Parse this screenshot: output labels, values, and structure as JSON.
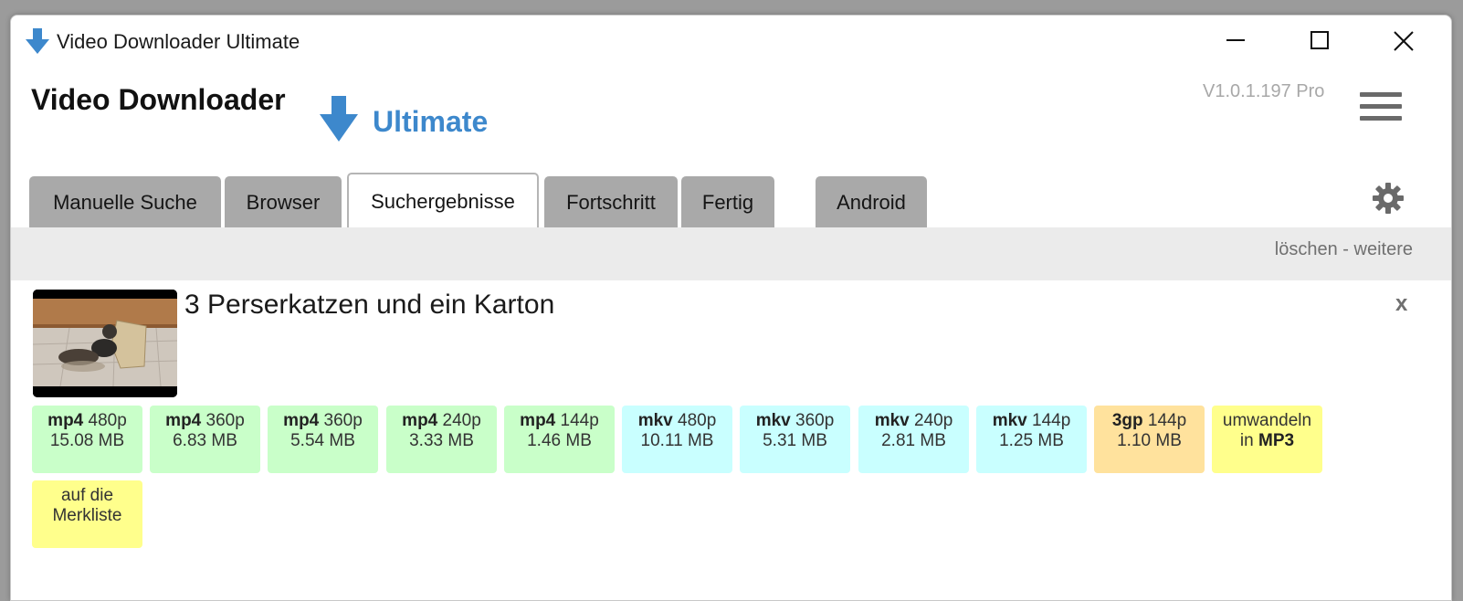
{
  "window": {
    "title": "Video Downloader Ultimate"
  },
  "header": {
    "app_name": "Video Downloader",
    "app_sub": "Ultimate",
    "version": "V1.0.1.197 Pro"
  },
  "tabs": [
    {
      "label": "Manuelle Suche",
      "active": false
    },
    {
      "label": "Browser",
      "active": false
    },
    {
      "label": "Suchergebnisse",
      "active": true
    },
    {
      "label": "Fortschritt",
      "active": false
    },
    {
      "label": "Fertig",
      "active": false
    },
    {
      "label": "Android",
      "active": false
    }
  ],
  "toolbar": {
    "clear": "löschen",
    "separator": " - ",
    "more": "weitere"
  },
  "result": {
    "title": "3 Perserkatzen und ein Karton",
    "close": "x",
    "downloads": [
      {
        "format": "mp4",
        "quality": "480p",
        "size": "15.08 MB",
        "color": "#c9ffc9"
      },
      {
        "format": "mp4",
        "quality": "360p",
        "size": "6.83 MB",
        "color": "#c9ffc9"
      },
      {
        "format": "mp4",
        "quality": "360p",
        "size": "5.54 MB",
        "color": "#c9ffc9"
      },
      {
        "format": "mp4",
        "quality": "240p",
        "size": "3.33 MB",
        "color": "#c9ffc9"
      },
      {
        "format": "mp4",
        "quality": "144p",
        "size": "1.46 MB",
        "color": "#c9ffc9"
      },
      {
        "format": "mkv",
        "quality": "480p",
        "size": "10.11 MB",
        "color": "#c9ffff"
      },
      {
        "format": "mkv",
        "quality": "360p",
        "size": "5.31 MB",
        "color": "#c9ffff"
      },
      {
        "format": "mkv",
        "quality": "240p",
        "size": "2.81 MB",
        "color": "#c9ffff"
      },
      {
        "format": "mkv",
        "quality": "144p",
        "size": "1.25 MB",
        "color": "#c9ffff"
      },
      {
        "format": "3gp",
        "quality": "144p",
        "size": "1.10 MB",
        "color": "#ffe29d"
      }
    ],
    "convert": {
      "line1": "umwandeln",
      "line2_prefix": "in ",
      "line2_bold": "MP3",
      "color": "#ffff8c"
    },
    "watchlist": {
      "line1": "auf die",
      "line2": "Merkliste",
      "color": "#ffff8c"
    }
  },
  "icons": {
    "title_icon": "download-arrow-icon",
    "logo_icon": "download-arrow-icon",
    "menu_icon": "hamburger-menu-icon",
    "settings_icon": "gear-icon",
    "accent_color": "#3d88cc"
  }
}
